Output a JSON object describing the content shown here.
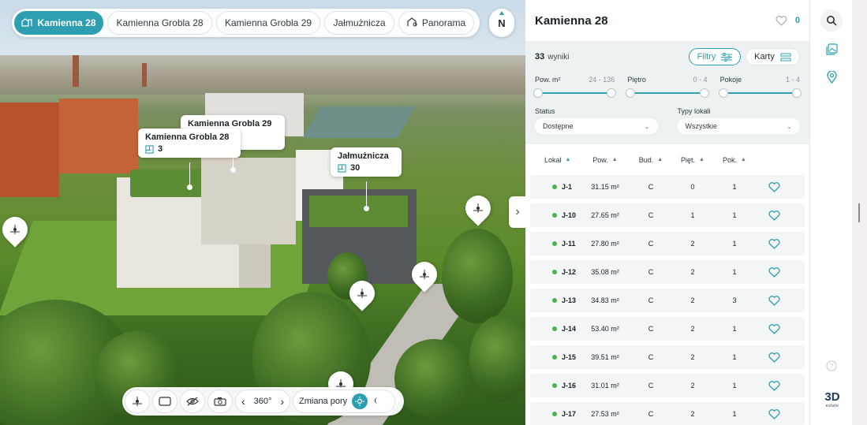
{
  "scene": {
    "tabs": [
      {
        "label": "Kamienna 28",
        "active": true,
        "icon": "building-icon"
      },
      {
        "label": "Kamienna Grobla 28",
        "active": false
      },
      {
        "label": "Kamienna Grobla 29",
        "active": false
      },
      {
        "label": "Jałmużnicza",
        "active": false
      },
      {
        "label": "Panorama",
        "active": false,
        "icon": "panorama-icon"
      }
    ],
    "compass_label": "N",
    "labels": [
      {
        "name": "Kamienna Grobla 29",
        "count": ""
      },
      {
        "name": "Kamienna Grobla 28",
        "count": "3"
      },
      {
        "name": "Jałmużnicza",
        "count": "30"
      }
    ],
    "toolbar": {
      "rotate_label": "360°",
      "time_label": "Zmiana pory"
    }
  },
  "panel": {
    "title": "Kamienna 28",
    "favorites_count": "0",
    "results_count": "33",
    "results_label": "wyniki",
    "filters_button": "Filtry",
    "cards_button": "Karty",
    "sliders": [
      {
        "label": "Pow. m²",
        "range": "24 - 136"
      },
      {
        "label": "Piętro",
        "range": "0 - 4"
      },
      {
        "label": "Pokoje",
        "range": "1 - 4"
      }
    ],
    "status": {
      "label": "Status",
      "value": "Dostępne"
    },
    "types": {
      "label": "Typy lokali",
      "value": "Wszystkie"
    },
    "columns": [
      "Lokal",
      "Pow.",
      "Bud.",
      "Pięt.",
      "Pok."
    ],
    "rows": [
      {
        "lokal": "J-1",
        "pow": "31.15 m²",
        "bud": "C",
        "pietro": "0",
        "pokoje": "1"
      },
      {
        "lokal": "J-10",
        "pow": "27.65 m²",
        "bud": "C",
        "pietro": "1",
        "pokoje": "1"
      },
      {
        "lokal": "J-11",
        "pow": "27.80 m²",
        "bud": "C",
        "pietro": "2",
        "pokoje": "1"
      },
      {
        "lokal": "J-12",
        "pow": "35.08 m²",
        "bud": "C",
        "pietro": "2",
        "pokoje": "1"
      },
      {
        "lokal": "J-13",
        "pow": "34.83 m²",
        "bud": "C",
        "pietro": "2",
        "pokoje": "3"
      },
      {
        "lokal": "J-14",
        "pow": "53.40 m²",
        "bud": "C",
        "pietro": "2",
        "pokoje": "1"
      },
      {
        "lokal": "J-15",
        "pow": "39.51 m²",
        "bud": "C",
        "pietro": "2",
        "pokoje": "1"
      },
      {
        "lokal": "J-16",
        "pow": "31.01 m²",
        "bud": "C",
        "pietro": "2",
        "pokoje": "1"
      },
      {
        "lokal": "J-17",
        "pow": "27.53 m²",
        "bud": "C",
        "pietro": "2",
        "pokoje": "1"
      }
    ]
  },
  "rail": {
    "brand": "3D",
    "brand_sub": "estate"
  },
  "colors": {
    "accent": "#2e9fb1",
    "available": "#4caf50"
  }
}
